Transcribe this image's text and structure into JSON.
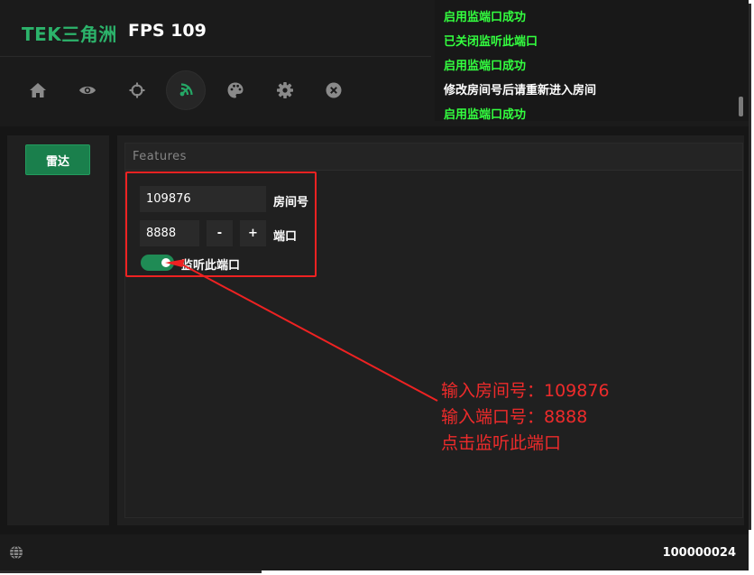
{
  "header": {
    "logo": "TEK三角洲",
    "fps": "FPS 109"
  },
  "nav": {
    "items": [
      {
        "icon": "home-icon"
      },
      {
        "icon": "eye-icon"
      },
      {
        "icon": "crosshair-icon"
      },
      {
        "icon": "radar-icon",
        "active": true
      },
      {
        "icon": "palette-icon"
      },
      {
        "icon": "gear-icon"
      },
      {
        "icon": "close-icon"
      }
    ]
  },
  "log": {
    "lines": [
      {
        "text": "启用监端口成功",
        "color": "green"
      },
      {
        "text": "已关闭监听此端口",
        "color": "green"
      },
      {
        "text": "启用监端口成功",
        "color": "green"
      },
      {
        "text": "修改房间号后请重新进入房间",
        "color": "white"
      },
      {
        "text": "启用监端口成功",
        "color": "green"
      }
    ]
  },
  "sidebar": {
    "radar_label": "雷达"
  },
  "features": {
    "title": "Features",
    "room_value": "109876",
    "room_label": "房间号",
    "port_value": "8888",
    "minus_label": "-",
    "plus_label": "+",
    "port_label": "端口",
    "listen_label": "监听此端口",
    "listen_enabled": true
  },
  "annotation": {
    "line1": "输入房间号：109876",
    "line2": "输入端口号：8888",
    "line3": "点击监听此端口"
  },
  "footer": {
    "account_id": "100000024"
  },
  "colors": {
    "accent": "#1f8b55",
    "log_green": "#33ff3f",
    "annotation_red": "#ee2222"
  }
}
